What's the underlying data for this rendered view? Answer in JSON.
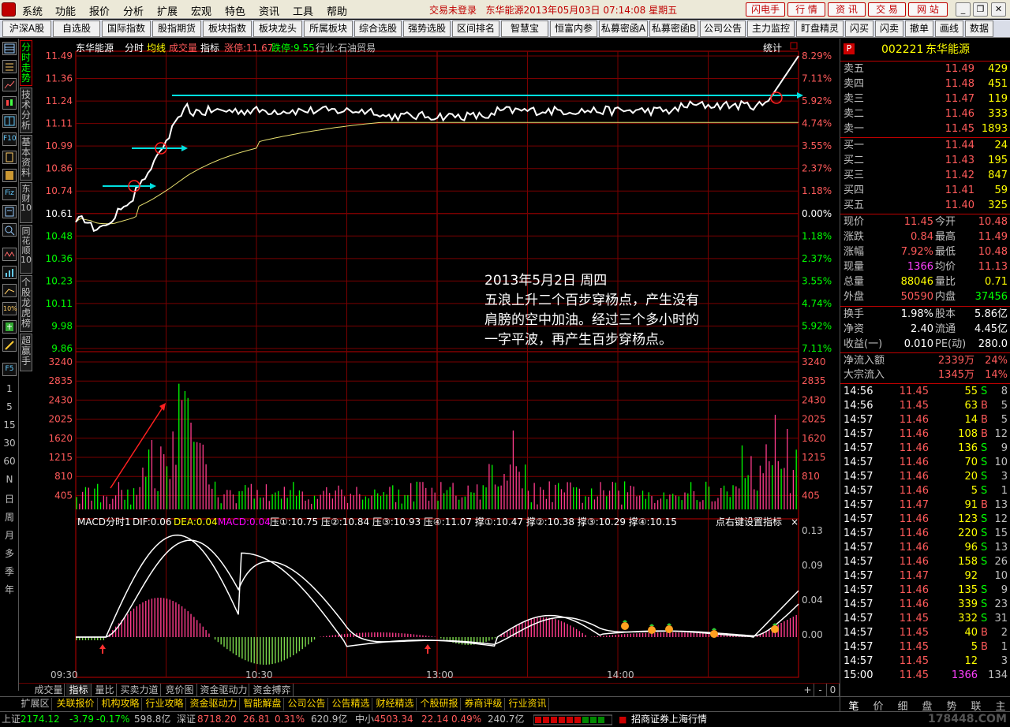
{
  "menu": [
    "系统",
    "功能",
    "报价",
    "分析",
    "扩展",
    "宏观",
    "特色",
    "资讯",
    "工具",
    "帮助"
  ],
  "trade_status": "交易未登录",
  "title_info": "东华能源2013年05月03日  07:14:08  星期五",
  "right_buttons": [
    "闪电手",
    "行 情",
    "资 讯",
    "交 易",
    "网 站"
  ],
  "window_buttons": [
    "_",
    "❐",
    "✕"
  ],
  "toolbar": [
    "沪深A股",
    "自选股",
    "国际指数",
    "股指期货",
    "板块指数",
    "板块龙头",
    "所属板块",
    "综合选股",
    "强势选股",
    "区间排名",
    "智慧宝",
    "恒富内参",
    "私募密函A",
    "私募密函B",
    "公司公告",
    "主力监控",
    "盯盘精灵",
    "闪买",
    "闪卖",
    "撤单",
    "画线",
    "数据"
  ],
  "vertical_tabs": [
    "分时走势",
    "技术分析",
    "基本资料",
    "东财10",
    "同花顺10",
    "个股龙虎榜",
    "超赢手"
  ],
  "left_numbers": [
    "1",
    "5",
    "15",
    "30",
    "60",
    "N",
    "日",
    "周",
    "月",
    "多",
    "季",
    "年"
  ],
  "left_icon_labels": {
    "f10": "F10",
    "f5": "F5",
    "fiz": "Fiz",
    "ten": "10%"
  },
  "chart_header": {
    "stock": "东华能源",
    "mode": "分时",
    "avg": "均线",
    "vol": "成交量",
    "ind": "指标",
    "limit_up": "涨停:11.67",
    "limit_down": "跌停:9.55",
    "industry": "行业:石油贸易",
    "stats": "统计"
  },
  "price_axis": [
    "11.49",
    "11.36",
    "11.24",
    "11.11",
    "10.99",
    "10.86",
    "10.74",
    "10.61",
    "10.48",
    "10.36",
    "10.23",
    "10.11",
    "9.98",
    "9.86"
  ],
  "pct_axis": [
    "8.29%",
    "7.11%",
    "5.92%",
    "4.74%",
    "3.55%",
    "2.37%",
    "1.18%",
    "0.00%",
    "1.18%",
    "2.37%",
    "3.55%",
    "4.74%",
    "5.92%",
    "7.11%"
  ],
  "vol_axis": [
    "3240",
    "2835",
    "2430",
    "2025",
    "1620",
    "1215",
    "810",
    "405"
  ],
  "macd_header": {
    "name": "MACD分时1",
    "dif": "DIF:0.06",
    "dea": "DEA:0.04",
    "macd": "MACD:0.04",
    "levels": "压①:10.75  压②:10.84  压③:10.93  压④:11.07  撑①:10.47  撑②:10.38  撑③:10.29  撑④:10.15",
    "hint": "点右键设置指标",
    "close": "×"
  },
  "macd_axis": [
    "0.13",
    "0.09",
    "0.04",
    "0.00"
  ],
  "time_axis": [
    "09:30",
    "10:30",
    "13:00",
    "14:00"
  ],
  "annotation": [
    "2013年5月2日 周四",
    "五浪上升二个百步穿杨点，产生没有",
    "肩膀的空中加油。经过三个多小时的",
    "一字平波，再产生百步穿杨点。"
  ],
  "chart_tabs": [
    "成交量",
    "指标",
    "量比",
    "买卖力道",
    "竞价图",
    "资金驱动力",
    "资金搏弈"
  ],
  "chart_tabs_right": [
    "+",
    "-",
    "0"
  ],
  "bottom_tabs": [
    "扩展区",
    "关联报价",
    "机构攻略",
    "行业攻略",
    "资金驱动力",
    "智能解盘",
    "公司公告",
    "公告精选",
    "财经精选",
    "个股研报",
    "券商评级",
    "行业资讯"
  ],
  "status": {
    "sh_label": "上证",
    "sh_val": "2174.12",
    "sh_chg": "-3.79",
    "sh_pct": "-0.17%",
    "sh_amt": "598.8亿",
    "sz_label": "深证",
    "sz_val": "8718.20",
    "sz_chg": "26.81",
    "sz_pct": "0.31%",
    "sz_amt": "620.9亿",
    "zx_label": "中小",
    "zx_val": "4503.34",
    "zx_chg": "22.14",
    "zx_pct": "0.49%",
    "zx_amt": "240.7亿",
    "broker": "招商证券上海行情",
    "watermark": "178448.COM"
  },
  "quote": {
    "p": "P",
    "code": "002221",
    "name": "东华能源",
    "asks": [
      [
        "卖五",
        "11.49",
        "429"
      ],
      [
        "卖四",
        "11.48",
        "451"
      ],
      [
        "卖三",
        "11.47",
        "119"
      ],
      [
        "卖二",
        "11.46",
        "333"
      ],
      [
        "卖一",
        "11.45",
        "1893"
      ]
    ],
    "bids": [
      [
        "买一",
        "11.44",
        "24"
      ],
      [
        "买二",
        "11.43",
        "195"
      ],
      [
        "买三",
        "11.42",
        "847"
      ],
      [
        "买四",
        "11.41",
        "59"
      ],
      [
        "买五",
        "11.40",
        "325"
      ]
    ],
    "stats": [
      [
        "现价",
        "11.45",
        "今开",
        "10.48"
      ],
      [
        "涨跌",
        "0.84",
        "最高",
        "11.49"
      ],
      [
        "涨幅",
        "7.92%",
        "最低",
        "10.48"
      ],
      [
        "现量",
        "1366",
        "均价",
        "11.13"
      ],
      [
        "总量",
        "88046",
        "量比",
        "0.71"
      ],
      [
        "外盘",
        "50590",
        "内盘",
        "37456"
      ]
    ],
    "stats2": [
      [
        "换手",
        "1.98%",
        "股本",
        "5.86亿"
      ],
      [
        "净资",
        "2.40",
        "流通",
        "4.45亿"
      ],
      [
        "收益(一)",
        "0.010",
        "PE(动)",
        "280.0"
      ]
    ],
    "flows": [
      [
        "净流入额",
        "2339万",
        "24%"
      ],
      [
        "大宗流入",
        "1345万",
        "14%"
      ]
    ],
    "ticks": [
      [
        "14:56",
        "11.45",
        "55",
        "S",
        "8"
      ],
      [
        "14:56",
        "11.45",
        "63",
        "B",
        "5"
      ],
      [
        "14:57",
        "11.46",
        "14",
        "B",
        "5"
      ],
      [
        "14:57",
        "11.46",
        "108",
        "B",
        "12"
      ],
      [
        "14:57",
        "11.46",
        "136",
        "S",
        "9"
      ],
      [
        "14:57",
        "11.46",
        "70",
        "S",
        "10"
      ],
      [
        "14:57",
        "11.46",
        "20",
        "S",
        "3"
      ],
      [
        "14:57",
        "11.46",
        "5",
        "S",
        "1"
      ],
      [
        "14:57",
        "11.47",
        "91",
        "B",
        "13"
      ],
      [
        "14:57",
        "11.46",
        "123",
        "S",
        "12"
      ],
      [
        "14:57",
        "11.46",
        "220",
        "S",
        "15"
      ],
      [
        "14:57",
        "11.46",
        "96",
        "S",
        "13"
      ],
      [
        "14:57",
        "11.46",
        "158",
        "S",
        "26"
      ],
      [
        "14:57",
        "11.47",
        "92",
        "",
        "10"
      ],
      [
        "14:57",
        "11.46",
        "135",
        "S",
        "9"
      ],
      [
        "14:57",
        "11.46",
        "339",
        "S",
        "23"
      ],
      [
        "14:57",
        "11.45",
        "332",
        "S",
        "31"
      ],
      [
        "14:57",
        "11.45",
        "40",
        "B",
        "2"
      ],
      [
        "14:57",
        "11.45",
        "5",
        "B",
        "1"
      ],
      [
        "14:57",
        "11.45",
        "12",
        "",
        "3"
      ],
      [
        "15:00",
        "11.45",
        "1366",
        "",
        "134"
      ]
    ],
    "bottom_tabs": [
      "笔",
      "价",
      "细",
      "盘",
      "势",
      "联",
      "主"
    ]
  }
}
